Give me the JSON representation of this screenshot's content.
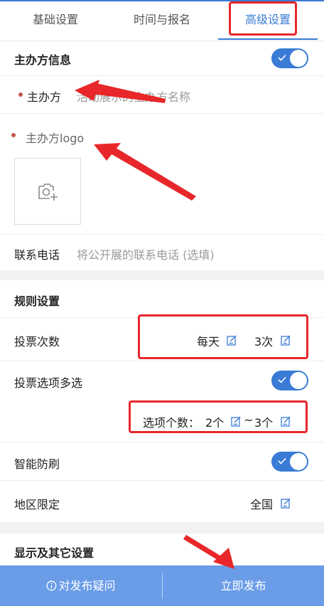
{
  "tabs": [
    {
      "label": "基础设置"
    },
    {
      "label": "时间与报名"
    },
    {
      "label": "高级设置",
      "active": true
    }
  ],
  "organizer": {
    "section_title": "主办方信息",
    "name_label": "主办方",
    "name_placeholder": "活动展示的主办方名称",
    "logo_label": "主办方logo",
    "phone_label": "联系电话",
    "phone_placeholder": "将公开展的联系电话 (选填)"
  },
  "rules": {
    "section_title": "规则设置",
    "vote_count_label": "投票次数",
    "vote_period": "每天",
    "vote_times": "3次",
    "multi_select_label": "投票选项多选",
    "option_count_prefix": "选项个数：",
    "option_min": "2个",
    "option_range_sep": "~",
    "option_max": "3个",
    "anti_brush_label": "智能防刷",
    "region_label": "地区限定",
    "region_value": "全国"
  },
  "display": {
    "section_title": "显示及其它设置"
  },
  "bottom": {
    "question_label": "对发布疑问",
    "publish_label": "立即发布"
  },
  "colors": {
    "accent": "#3a7bd5",
    "bottom_bar": "#6a9ce8",
    "required_dot": "#c0574a",
    "annotation_red": "#e8272a"
  }
}
